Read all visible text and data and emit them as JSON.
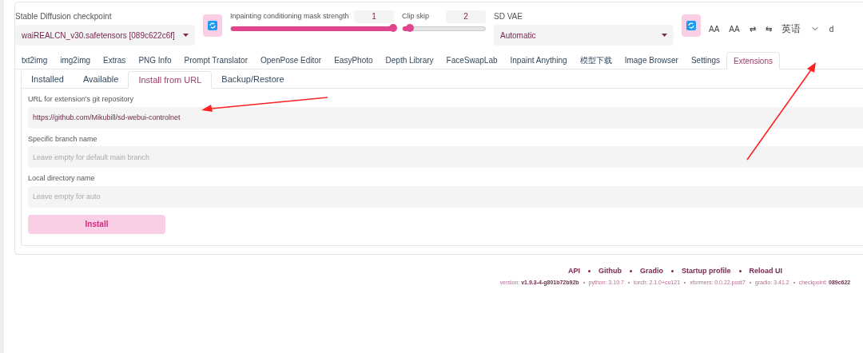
{
  "top": {
    "checkpoint": {
      "label": "Stable Diffusion checkpoint",
      "value": "waiREALCN_v30.safetensors [089c622c6f]"
    },
    "sliders": [
      {
        "label": "Inpainting conditioning mask strength",
        "value": "1",
        "level": 1
      },
      {
        "label": "Clip skip",
        "value": "2",
        "level": 0.09
      }
    ],
    "vae": {
      "label": "SD VAE",
      "value": "Automatic"
    },
    "toolbar": [
      "AA",
      "AA",
      "⇄",
      "⇆",
      "英语",
      "d"
    ]
  },
  "tabs": [
    {
      "label": "txt2img",
      "selected": false
    },
    {
      "label": "img2img",
      "selected": false
    },
    {
      "label": "Extras",
      "selected": false
    },
    {
      "label": "PNG Info",
      "selected": false
    },
    {
      "label": "Prompt Translator",
      "selected": false
    },
    {
      "label": "OpenPose Editor",
      "selected": false
    },
    {
      "label": "EasyPhoto",
      "selected": false
    },
    {
      "label": "Depth Library",
      "selected": false
    },
    {
      "label": "FaceSwapLab",
      "selected": false
    },
    {
      "label": "Inpaint Anything",
      "selected": false
    },
    {
      "label": "模型下载",
      "selected": false
    },
    {
      "label": "Image Browser",
      "selected": false
    },
    {
      "label": "Settings",
      "selected": false
    },
    {
      "label": "Extensions",
      "selected": true
    }
  ],
  "subtabs": [
    {
      "label": "Installed",
      "selected": false
    },
    {
      "label": "Available",
      "selected": false
    },
    {
      "label": "Install from URL",
      "selected": true
    },
    {
      "label": "Backup/Restore",
      "selected": false
    }
  ],
  "fields": [
    {
      "label": "URL for extension's git repository",
      "value": "https://github.com/Mikubill/sd-webui-controlnet"
    },
    {
      "label": "Specific branch name",
      "placeholder": "Leave empty for default main branch"
    },
    {
      "label": "Local directory name",
      "placeholder": "Leave empty for auto"
    }
  ],
  "install_button": "Install",
  "footer": {
    "links": [
      "API",
      "Github",
      "Gradio",
      "Startup profile",
      "Reload UI"
    ],
    "versions": [
      "version: **v1.9.3-4-g801b72b92b**",
      "python: 3.10.7",
      "torch: 2.1.0+cu121",
      "xformers: 0.0.22.post7",
      "gradio: 3.41.2",
      "checkpoint: **089c622**"
    ]
  }
}
